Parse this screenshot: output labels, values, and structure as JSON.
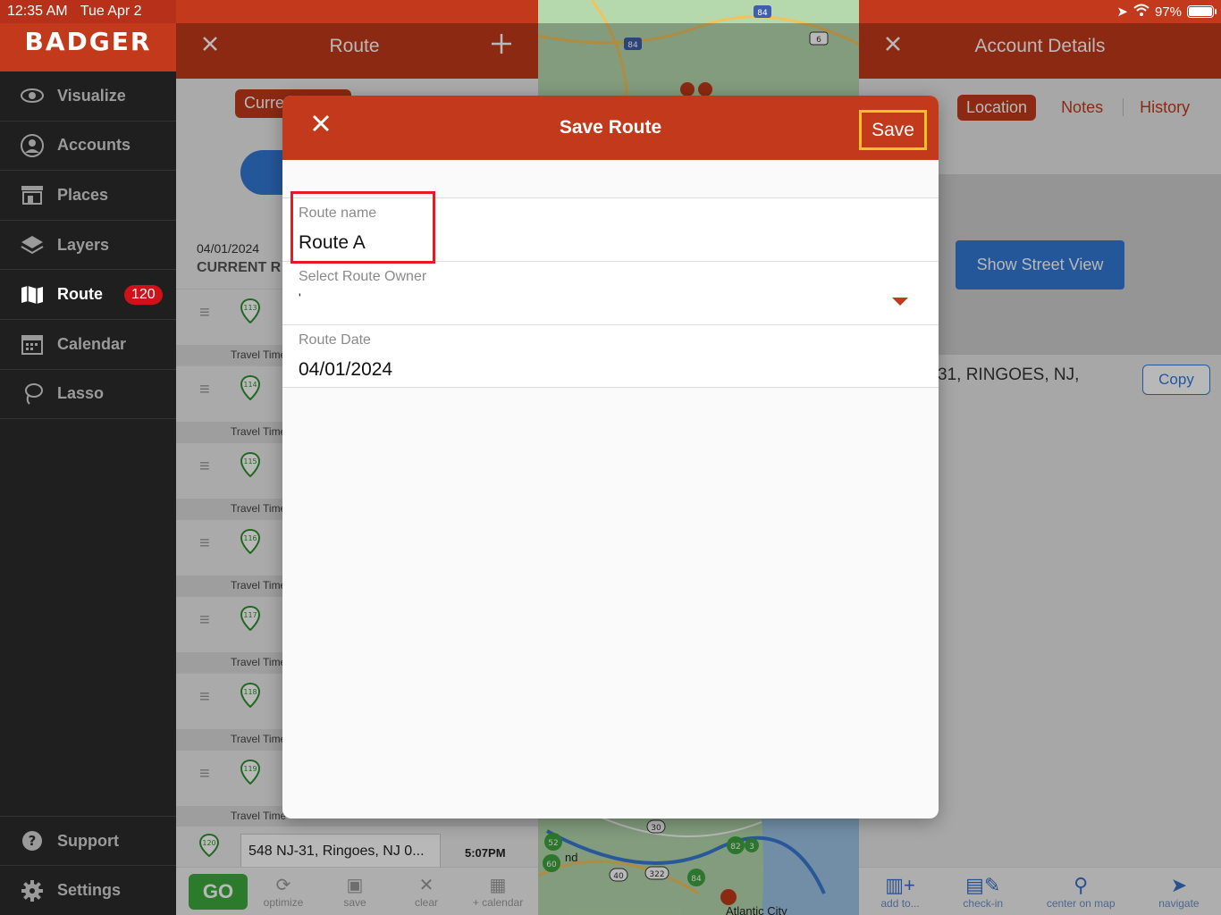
{
  "status": {
    "time": "12:35 AM",
    "date": "Tue Apr 2",
    "battery": "97%"
  },
  "sidebar": {
    "logo": "BADGER",
    "items": [
      {
        "label": "Visualize",
        "icon": "eye-icon"
      },
      {
        "label": "Accounts",
        "icon": "person-icon"
      },
      {
        "label": "Places",
        "icon": "store-icon"
      },
      {
        "label": "Layers",
        "icon": "layers-icon"
      },
      {
        "label": "Route",
        "icon": "map-icon",
        "badge": "120",
        "active": true
      },
      {
        "label": "Calendar",
        "icon": "calendar-icon"
      },
      {
        "label": "Lasso",
        "icon": "lasso-icon"
      }
    ],
    "bottom": [
      {
        "label": "Support",
        "icon": "help-icon"
      },
      {
        "label": "Settings",
        "icon": "gear-icon"
      }
    ]
  },
  "route_panel": {
    "title": "Route",
    "segment_current": "Curre",
    "date": "04/01/2024",
    "current_label": "CURRENT R",
    "stops": [
      "113",
      "114",
      "115",
      "116",
      "117",
      "118",
      "119"
    ],
    "travel_label": "Travel Time",
    "last_stop": {
      "number": "120",
      "address": "548 NJ-31, Ringoes, NJ 0...",
      "time": "5:07PM"
    },
    "footer": {
      "go": "GO",
      "optimize": "optimize",
      "save": "save",
      "clear": "clear",
      "calendar": "+ calendar"
    }
  },
  "map": {
    "shields": [
      "84",
      "84",
      "6",
      "30",
      "40",
      "322",
      "84",
      "82",
      "3"
    ],
    "markers": [
      "52",
      "60"
    ],
    "place_labels": [
      "Atlantic City",
      "nd"
    ]
  },
  "account_panel": {
    "title": "Account Details",
    "tabs": [
      "Location",
      "Notes",
      "History"
    ],
    "street_view_button": "Show Street View",
    "address": "31, RINGOES, NJ,",
    "copy_button": "Copy",
    "footer": {
      "add": "add to...",
      "checkin": "check-in",
      "center": "center on map",
      "navigate": "navigate"
    }
  },
  "modal": {
    "title": "Save Route",
    "save_label": "Save",
    "route_name_label": "Route name",
    "route_name_value": "Route A",
    "owner_label": "Select Route Owner",
    "owner_value": "'",
    "date_label": "Route Date",
    "date_value": "04/01/2024"
  },
  "colors": {
    "brand": "#c23a1b",
    "accent_blue": "#3279d6",
    "go_green": "#3eab3f",
    "highlight_red": "#e31b23",
    "highlight_yellow": "#f7c323"
  }
}
